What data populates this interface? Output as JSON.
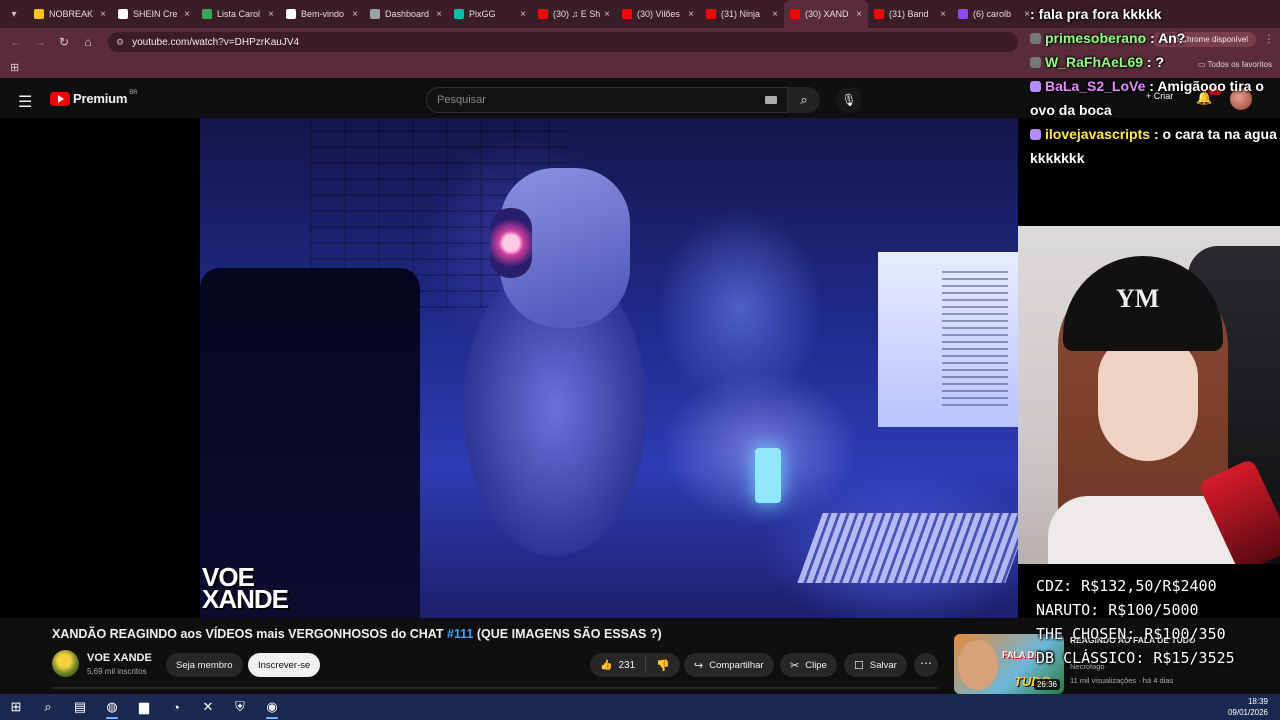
{
  "browser": {
    "tabs": [
      {
        "label": "NOBREAK",
        "color": "#f5c518"
      },
      {
        "label": "SHEIN Cre",
        "color": "#ffffff"
      },
      {
        "label": "Lista Carol",
        "color": "#34a853"
      },
      {
        "label": "Bem-vindo",
        "color": "#ffffff"
      },
      {
        "label": "Dashboard",
        "color": "#9aa0a6"
      },
      {
        "label": "PixGG",
        "color": "#00c2a8"
      },
      {
        "label": "(30) ♫ E Sh",
        "color": "#ff0000"
      },
      {
        "label": "(30) Vilões",
        "color": "#ff0000"
      },
      {
        "label": "(31) Ninja",
        "color": "#ff0000"
      },
      {
        "label": "(30) XAND",
        "color": "#ff0000",
        "active": true
      },
      {
        "label": "(31) Band",
        "color": "#ff0000"
      },
      {
        "label": "(6) carolb",
        "color": "#9146ff"
      }
    ],
    "url": "youtube.com/watch?v=DHPzrKauJV4",
    "update_label": "Novo Chrome disponível",
    "all_bookmarks_label": "Todos os favoritos"
  },
  "youtube": {
    "logo_word": "Premium",
    "country_code": "BR",
    "search_placeholder": "Pesquisar",
    "create_label": "Criar",
    "notifications_count": "9+",
    "video": {
      "watermark_line1": "VOE",
      "watermark_line2": "XANDE",
      "title_before_hashtag": "XANDÃO REAGINDO aos VÍDEOS mais VERGONHOSOS do CHAT ",
      "hashtag": "#111",
      "title_after_hashtag": " (QUE IMAGENS SÃO ESSAS ?)"
    },
    "channel": {
      "name": "VOE XANDE",
      "subscribers": "5,69 mil inscritos",
      "join_label": "Seja membro",
      "subscribe_label": "Inscrever-se"
    },
    "actions": {
      "likes": "231",
      "share_label": "Compartilhar",
      "clip_label": "Clipe",
      "save_label": "Salvar"
    },
    "recommended": {
      "title": "REAGINDO AO FALA DE TUDO",
      "thumb_text": "FALA DE",
      "thumb_brand": "TUDO",
      "duration": "26:36",
      "channel": "Necrofago",
      "views": "11 mil visualizações",
      "age": "há 4 dias",
      "meta": "11 mil visualizações · há 4 dias"
    }
  },
  "stream_overlay": {
    "chat": [
      {
        "user": "",
        "message": "fala pra fora kkkkk",
        "user_color": "#cfe0ff"
      },
      {
        "user": "primesoberano",
        "message": "An?",
        "user_color": "#8cff7c"
      },
      {
        "user": "W_RaFhAeL69",
        "message": "?",
        "user_color": "#8cff7c"
      },
      {
        "user": "BaLa_S2_LoVe",
        "message": "Amigãooo tira o ovo da boca",
        "user_color": "#e889ff"
      },
      {
        "user": "ilovejavascripts",
        "message": "o cara ta na agua kkkkkkk",
        "user_color": "#ffeb3b"
      }
    ],
    "goals": [
      "CDZ: R$132,50/R$2400",
      "NARUTO: R$100/5000",
      "THE CHOSEN: R$100/350",
      "DB CLÁSSICO: R$15/3525"
    ]
  },
  "taskbar": {
    "time": "18:39",
    "date": "09/01/2026"
  }
}
